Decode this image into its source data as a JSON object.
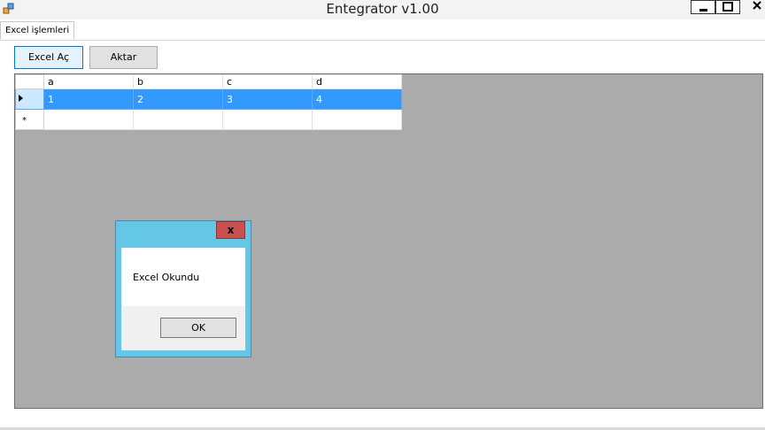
{
  "window": {
    "title": "Entegrator v1.00"
  },
  "tabs": [
    {
      "label": "Excel işlemleri"
    }
  ],
  "toolbar": {
    "excel_open_label": "Excel Aç",
    "transfer_label": "Aktar"
  },
  "grid": {
    "columns": [
      "a",
      "b",
      "c",
      "d"
    ],
    "rows": [
      [
        "1",
        "2",
        "3",
        "4"
      ]
    ],
    "selected_row": 0,
    "new_row_marker": "*"
  },
  "dialog": {
    "message": "Excel Okundu",
    "ok_label": "OK",
    "close_glyph": "x"
  },
  "colors": {
    "selection": "#3399ff",
    "dialog_frame": "#64c7e6",
    "close_button": "#c75050"
  }
}
